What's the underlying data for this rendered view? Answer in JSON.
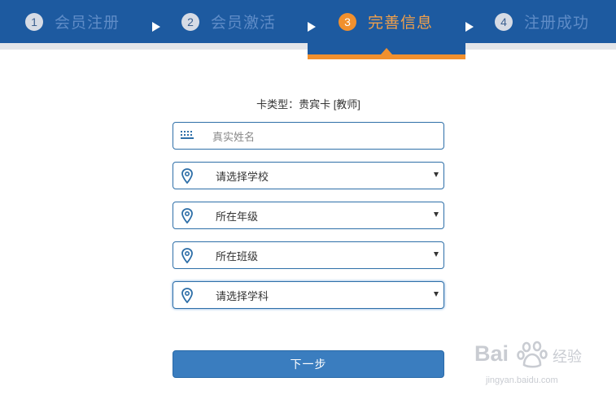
{
  "steps": [
    {
      "num": "1",
      "label": "会员注册"
    },
    {
      "num": "2",
      "label": "会员激活"
    },
    {
      "num": "3",
      "label": "完善信息"
    },
    {
      "num": "4",
      "label": "注册成功"
    }
  ],
  "active_step": 3,
  "card_type": "卡类型：贵宾卡 [教师]",
  "fields": {
    "name": {
      "placeholder": "真实姓名",
      "icon": "keyboard-icon"
    },
    "school": {
      "value": "请选择学校",
      "icon": "location-pin-icon"
    },
    "grade": {
      "value": "所在年级",
      "icon": "location-pin-icon"
    },
    "class": {
      "value": "所在班级",
      "icon": "location-pin-icon"
    },
    "subject": {
      "value": "请选择学科",
      "icon": "location-pin-icon"
    }
  },
  "next_button": "下一步",
  "watermark": {
    "main": "Bai",
    "cn": "经验",
    "sub": "jingyan.baidu.com"
  },
  "colors": {
    "header": "#1d5aa0",
    "accent": "#f1902e",
    "button": "#3a7dbf",
    "border": "#2e6fa8"
  }
}
